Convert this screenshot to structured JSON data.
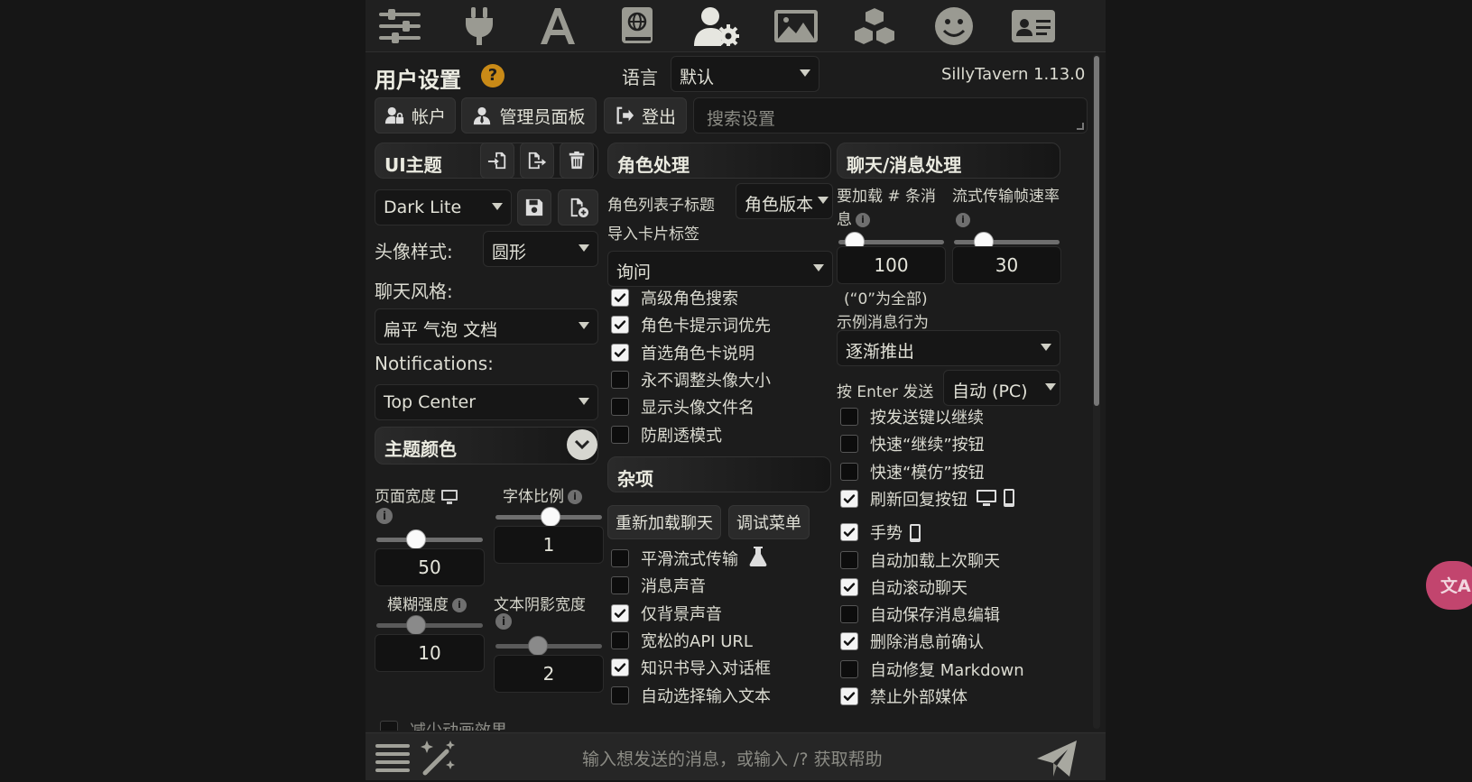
{
  "topbar": {
    "icons": [
      "sliders-icon",
      "plug-icon",
      "font-icon",
      "book-globe-icon",
      "user-cog-icon",
      "landscape-icon",
      "cubes-icon",
      "smiley-icon",
      "id-card-icon"
    ]
  },
  "header": {
    "title": "用户设置",
    "help": "?",
    "language_label": "语言",
    "language_value": "默认",
    "version": "SillyTavern 1.13.0"
  },
  "actions": {
    "account": "帐户",
    "admin_panel": "管理员面板",
    "logout": "登出",
    "search_placeholder": "搜索设置"
  },
  "col1": {
    "ui_theme_title": "UI主题",
    "theme_value": "Dark Lite",
    "avatar_style_label": "头像样式:",
    "avatar_style_value": "圆形",
    "chat_style_label": "聊天风格:",
    "chat_style_value": "扁平 气泡 文档",
    "notifications_label": "Notifications:",
    "notifications_value": "Top Center",
    "theme_colors_title": "主题颜色",
    "page_width_label": "页面宽度",
    "page_width_value": "50",
    "font_scale_label": "字体比例",
    "font_scale_value": "1",
    "blur_label": "模糊强度",
    "blur_value": "10",
    "shadow_label": "文本阴影宽度",
    "shadow_value": "2",
    "cut_label": "减少动画效果"
  },
  "col2": {
    "title": "角色处理",
    "char_list_subtitle_label": "角色列表子标题",
    "char_list_subtitle_value": "角色版本",
    "import_tags_label": "导入卡片标签",
    "import_tags_value": "询问",
    "checks": [
      {
        "label": "高级角色搜索",
        "checked": true
      },
      {
        "label": "角色卡提示词优先",
        "checked": true
      },
      {
        "label": "首选角色卡说明",
        "checked": true
      },
      {
        "label": "永不调整头像大小",
        "checked": false
      },
      {
        "label": "显示头像文件名",
        "checked": false
      },
      {
        "label": "防剧透模式",
        "checked": false
      }
    ],
    "misc_title": "杂项",
    "reload_chat": "重新加载聊天",
    "debug_menu": "调试菜单",
    "misc_checks": [
      {
        "label": "平滑流式传输",
        "checked": false
      },
      {
        "label": "消息声音",
        "checked": false
      },
      {
        "label": "仅背景声音",
        "checked": true
      },
      {
        "label": "宽松的API URL",
        "checked": false
      },
      {
        "label": "知识书导入对话框",
        "checked": true
      },
      {
        "label": "自动选择输入文本",
        "checked": false
      }
    ]
  },
  "col3": {
    "title": "聊天/消息处理",
    "load_msgs_label": "要加载 # 条消息",
    "load_msgs_value": "100",
    "stream_fps_label": "流式传输帧速率",
    "stream_fps_value": "30",
    "zero_note": "(“0”为全部)",
    "example_msgs_label": "示例消息行为",
    "example_msgs_value": "逐渐推出",
    "enter_send_label": "按 Enter 发送",
    "enter_send_value": "自动 (PC)",
    "checks": [
      {
        "label": "按发送键以继续",
        "checked": false
      },
      {
        "label": "快速“继续”按钮",
        "checked": false
      },
      {
        "label": "快速“模仿”按钮",
        "checked": false
      },
      {
        "label": "刷新回复按钮",
        "checked": true
      },
      {
        "label": "手势",
        "checked": true
      },
      {
        "label": "自动加载上次聊天",
        "checked": false
      },
      {
        "label": "自动滚动聊天",
        "checked": true
      },
      {
        "label": "自动保存消息编辑",
        "checked": false
      },
      {
        "label": "删除消息前确认",
        "checked": true
      },
      {
        "label": "自动修复 Markdown",
        "checked": false
      },
      {
        "label": "禁止外部媒体",
        "checked": true
      }
    ]
  },
  "bottom": {
    "input_placeholder": "输入想发送的消息，或输入 /? 获取帮助"
  },
  "floating": {
    "translate": "文A"
  },
  "colors": {
    "help_badge": "#c98a17",
    "translate_badge": "#c2456e"
  }
}
